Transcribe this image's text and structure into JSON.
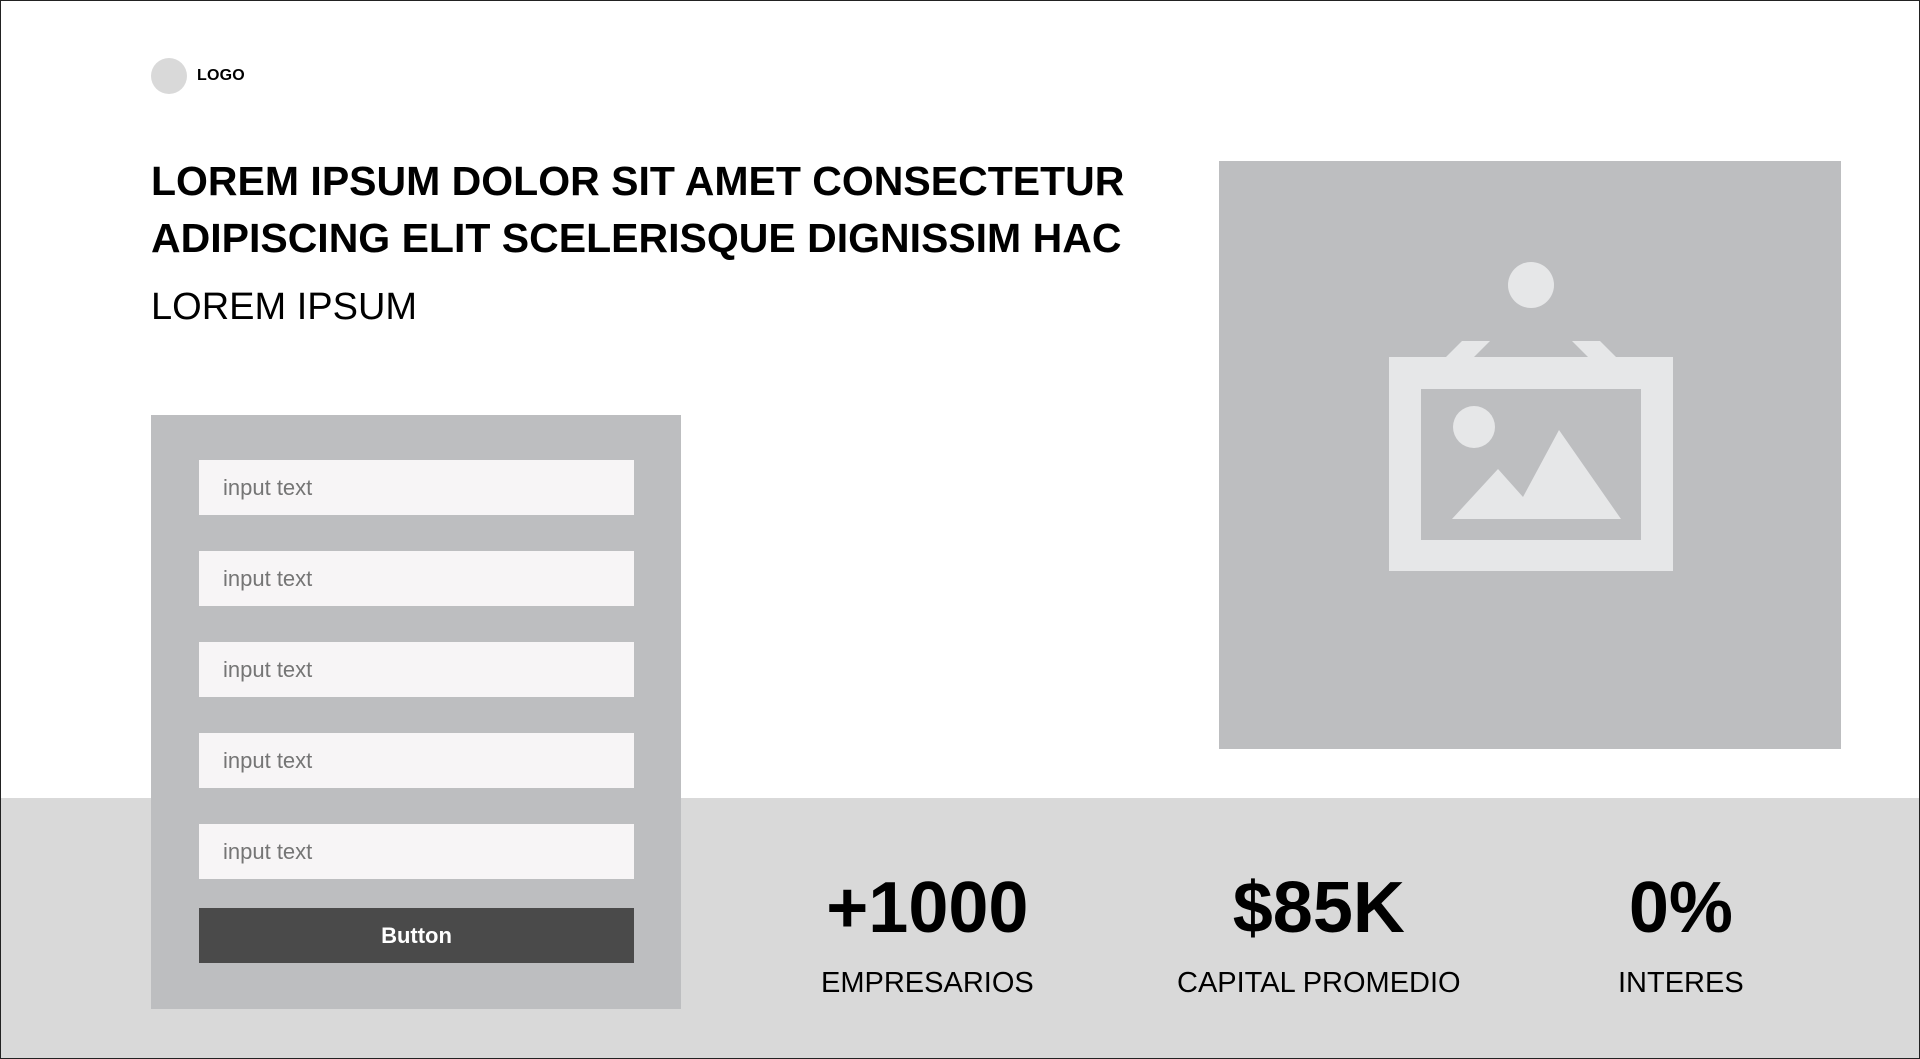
{
  "header": {
    "logo_text": "LOGO",
    "headline_line1": "LOREM IPSUM DOLOR SIT AMET CONSECTETUR",
    "headline_line2": "ADIPISCING ELIT SCELERISQUE DIGNISSIM HAC",
    "subheadline": "LOREM IPSUM"
  },
  "form": {
    "fields": [
      {
        "placeholder": "input text"
      },
      {
        "placeholder": "input text"
      },
      {
        "placeholder": "input text"
      },
      {
        "placeholder": "input text"
      },
      {
        "placeholder": "input text"
      }
    ],
    "button_label": "Button"
  },
  "media": {
    "icon": "image-placeholder-icon"
  },
  "stats": [
    {
      "value": "+1000",
      "label": "EMPRESARIOS"
    },
    {
      "value": "$85K",
      "label": "CAPITAL PROMEDIO"
    },
    {
      "value": "0%",
      "label": "INTERES"
    }
  ],
  "colors": {
    "page_background": "#ffffff",
    "band_background": "#d9d9d9",
    "panel_background": "#bdbec0",
    "input_background": "#f7f5f6",
    "button_background": "#4a4a4a",
    "button_text": "#ffffff",
    "icon_fill": "#e6e7e8"
  }
}
